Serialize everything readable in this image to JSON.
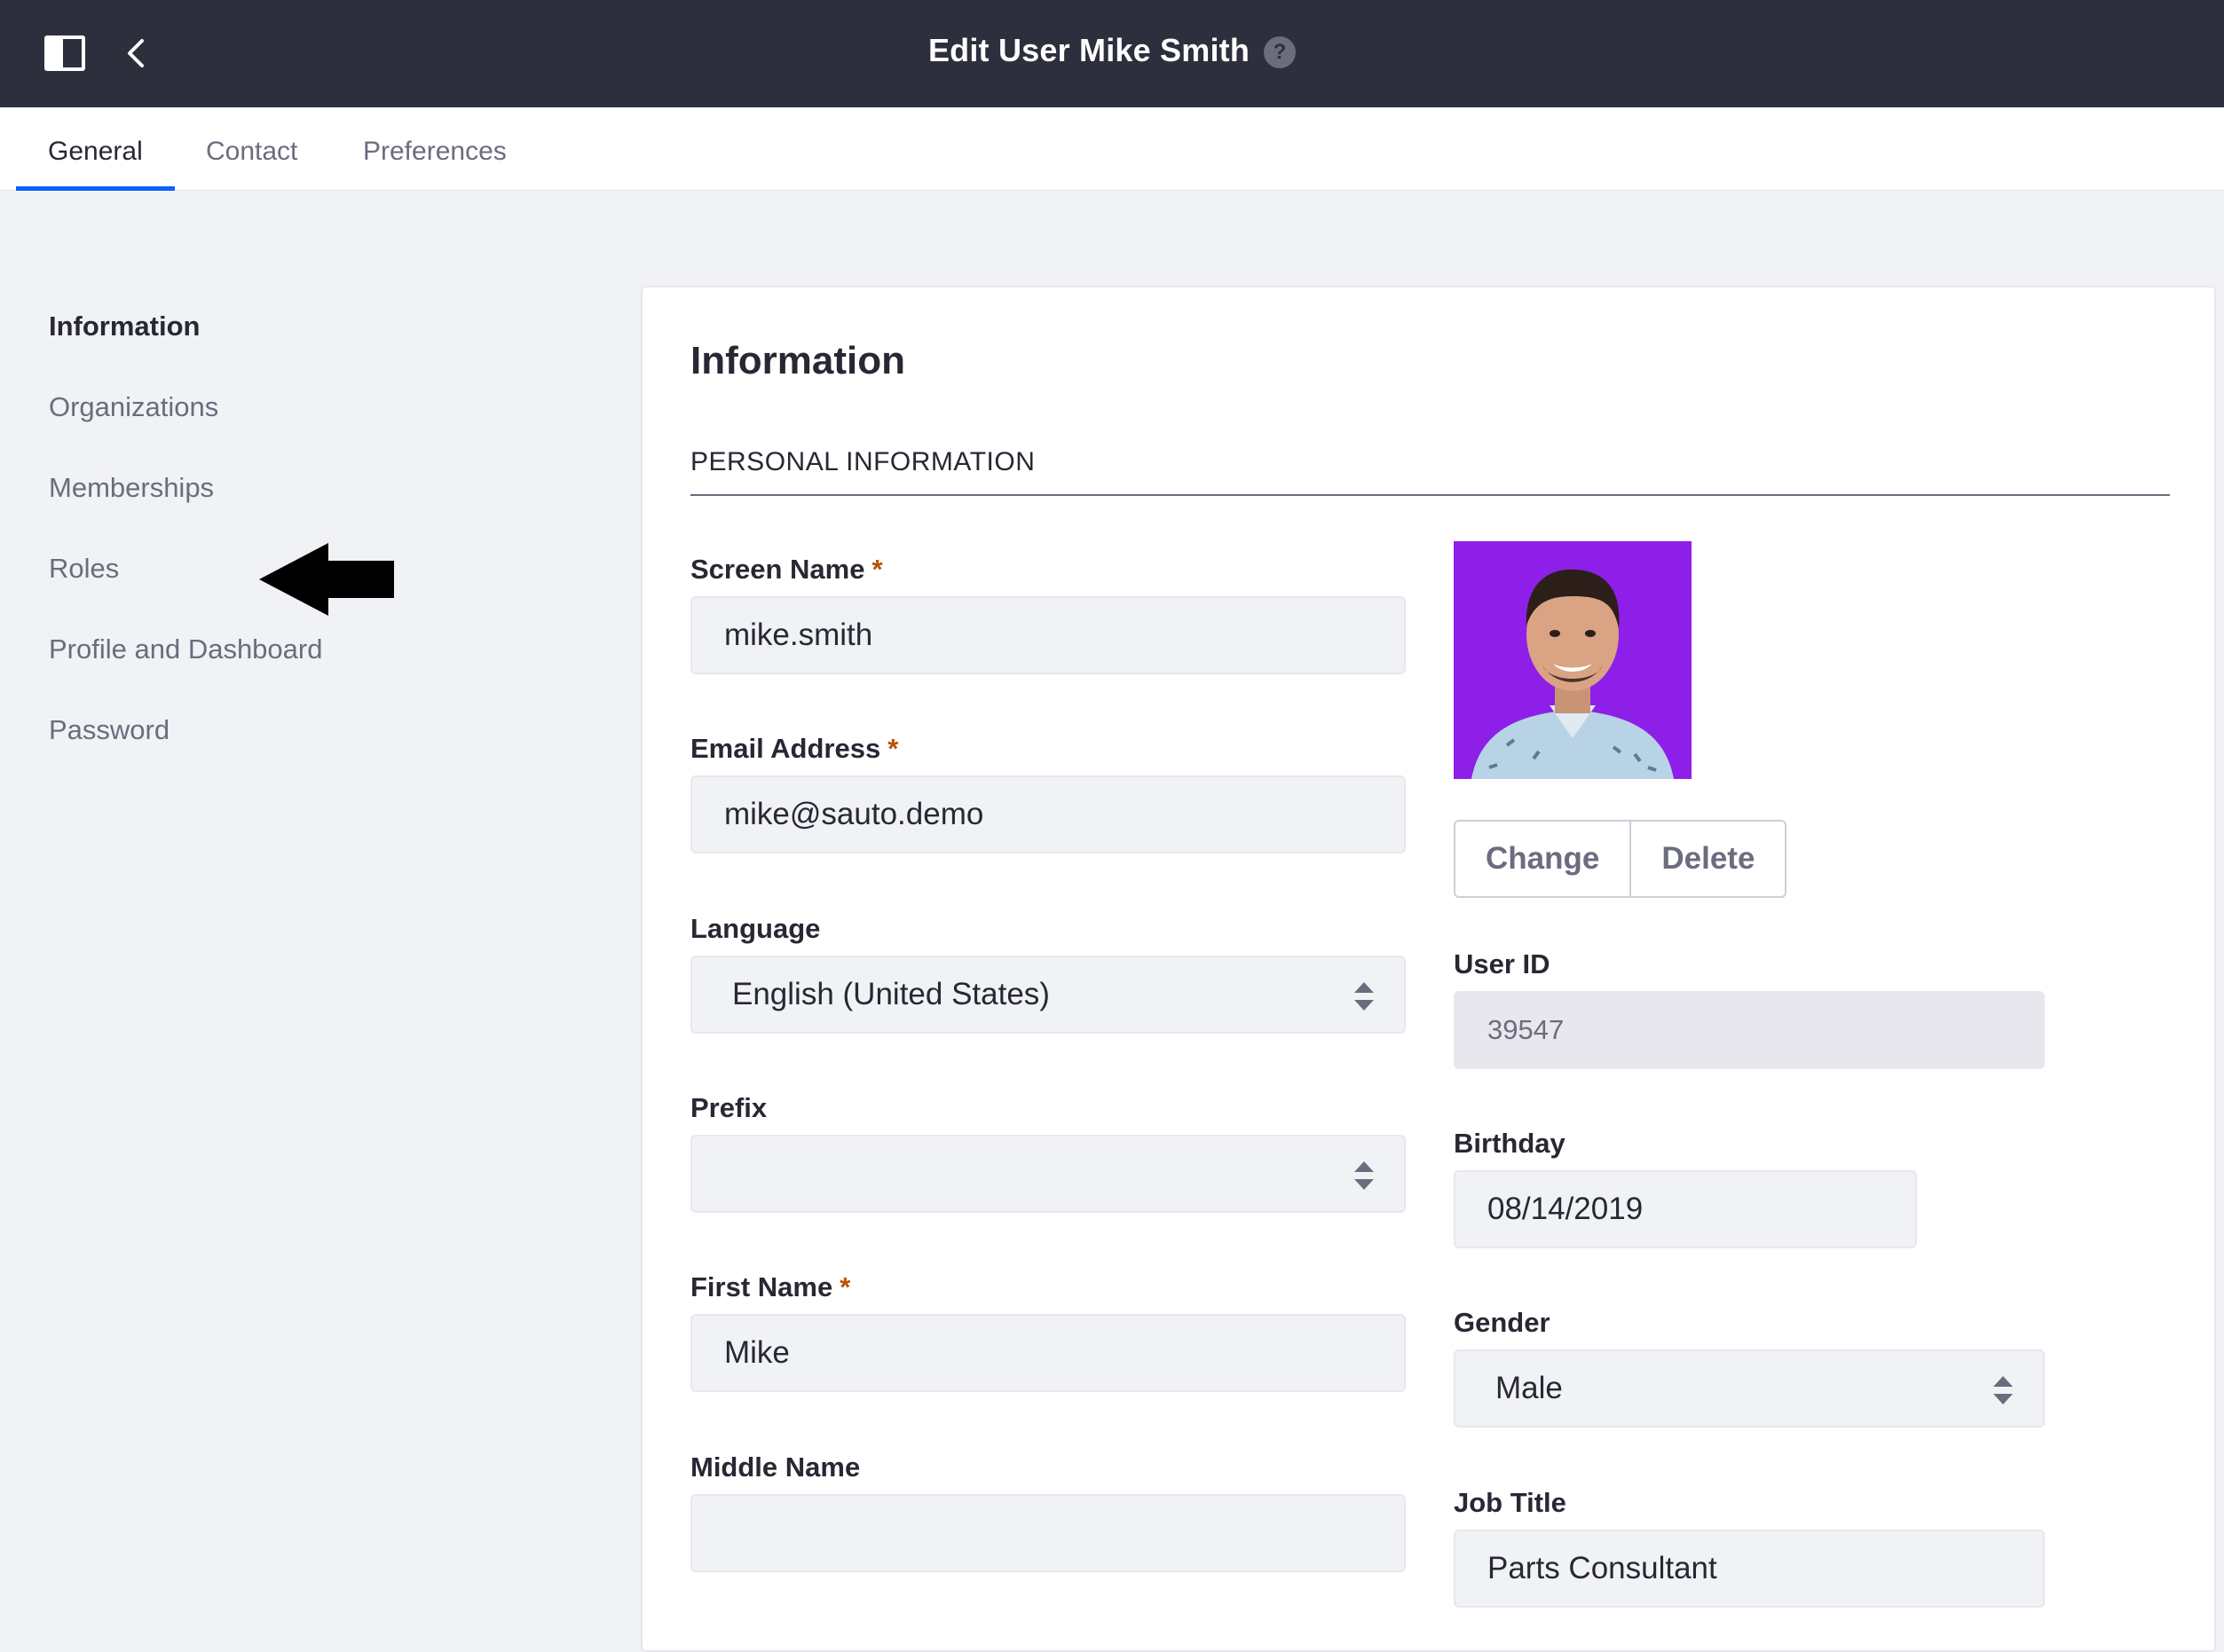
{
  "header": {
    "title": "Edit User Mike Smith",
    "help_glyph": "?",
    "icons": [
      "panel-toggle-icon",
      "back-chevron-icon",
      "help-icon"
    ]
  },
  "tabs": [
    {
      "label": "General",
      "active": true
    },
    {
      "label": "Contact",
      "active": false
    },
    {
      "label": "Preferences",
      "active": false
    }
  ],
  "sidenav": {
    "items": [
      {
        "label": "Information",
        "active": true
      },
      {
        "label": "Organizations",
        "active": false
      },
      {
        "label": "Memberships",
        "active": false
      },
      {
        "label": "Roles",
        "active": false
      },
      {
        "label": "Profile and Dashboard",
        "active": false
      },
      {
        "label": "Password",
        "active": false
      }
    ]
  },
  "card": {
    "title": "Information",
    "section_title": "PERSONAL INFORMATION"
  },
  "form": {
    "required_mark": "*",
    "screen_name": {
      "label": "Screen Name",
      "value": "mike.smith"
    },
    "email": {
      "label": "Email Address",
      "value": "mike@sauto.demo"
    },
    "language": {
      "label": "Language",
      "value": "English (United States)"
    },
    "prefix": {
      "label": "Prefix",
      "value": ""
    },
    "first_name": {
      "label": "First Name",
      "value": "Mike"
    },
    "middle_name": {
      "label": "Middle Name",
      "value": ""
    },
    "user_id": {
      "label": "User ID",
      "value": "39547"
    },
    "birthday": {
      "label": "Birthday",
      "value": "08/14/2019"
    },
    "gender": {
      "label": "Gender",
      "value": "Male"
    },
    "job_title": {
      "label": "Job Title",
      "value": "Parts Consultant"
    }
  },
  "photo": {
    "change_label": "Change",
    "delete_label": "Delete",
    "background_color": "#8e1fe8"
  },
  "colors": {
    "header_bg": "#2e2f3d",
    "accent": "#0b5fff",
    "required": "#b95000"
  }
}
